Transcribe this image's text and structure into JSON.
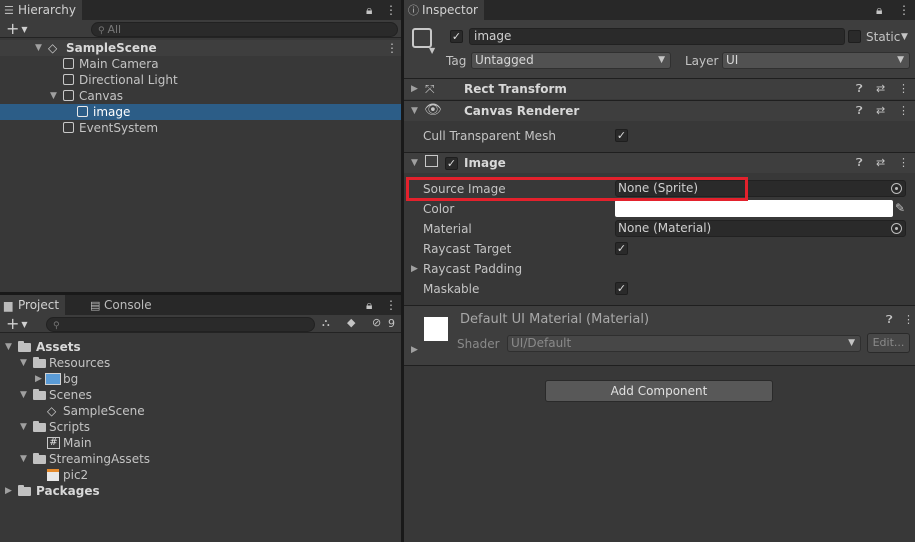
{
  "hierarchy": {
    "tab_label": "Hierarchy",
    "search_placeholder": "All",
    "scene": "SampleScene",
    "items": [
      "Main Camera",
      "Directional Light",
      "Canvas",
      "image",
      "EventSystem"
    ]
  },
  "project": {
    "tabs": [
      "Project",
      "Console"
    ],
    "hidden_count": "9",
    "tree": {
      "assets": "Assets",
      "resources": "Resources",
      "bg": "bg",
      "scenes": "Scenes",
      "samplescene": "SampleScene",
      "scripts": "Scripts",
      "main": "Main",
      "streaming": "StreamingAssets",
      "pic2": "pic2",
      "packages": "Packages"
    }
  },
  "inspector": {
    "tab_label": "Inspector",
    "object_name": "image",
    "static_label": "Static",
    "tag_label": "Tag",
    "tag_value": "Untagged",
    "layer_label": "Layer",
    "layer_value": "UI",
    "components": {
      "rect_transform": "Rect Transform",
      "canvas_renderer": "Canvas Renderer",
      "cull_label": "Cull Transparent Mesh",
      "image": "Image",
      "source_image_label": "Source Image",
      "source_image_value": "None (Sprite)",
      "color_label": "Color",
      "color_value": "#ffffff",
      "material_label": "Material",
      "material_value": "None (Material)",
      "raycast_target_label": "Raycast Target",
      "raycast_padding_label": "Raycast Padding",
      "maskable_label": "Maskable"
    },
    "material_block": {
      "title": "Default UI Material (Material)",
      "shader_label": "Shader",
      "shader_value": "UI/Default",
      "edit_label": "Edit..."
    },
    "add_component": "Add Component"
  }
}
